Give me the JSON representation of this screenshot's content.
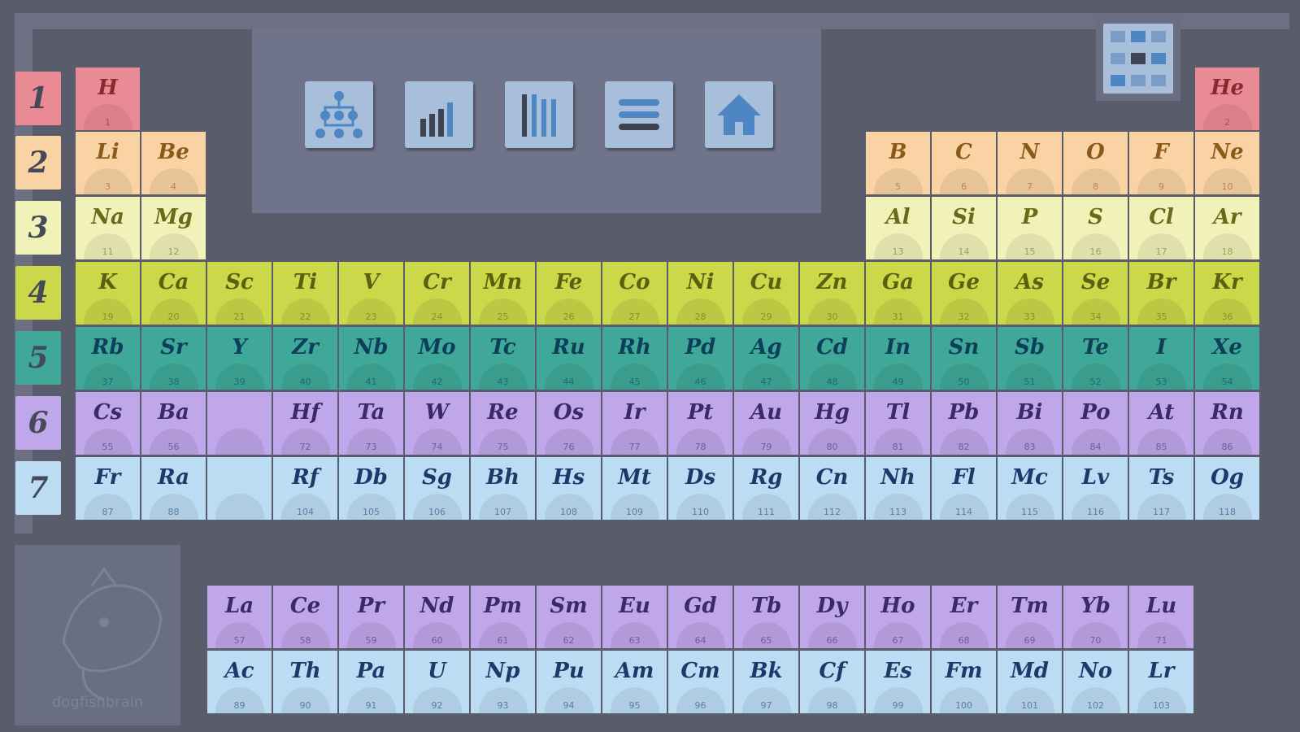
{
  "toolbar": {
    "buttons": [
      {
        "name": "tree-view-button",
        "icon": "tree-icon"
      },
      {
        "name": "chart-view-button",
        "icon": "bar-chart-icon"
      },
      {
        "name": "columns-view-button",
        "icon": "columns-icon"
      },
      {
        "name": "list-view-button",
        "icon": "list-icon"
      },
      {
        "name": "home-button",
        "icon": "home-icon"
      }
    ],
    "grid_button_icon": "grid-icon"
  },
  "periods": [
    "1",
    "2",
    "3",
    "4",
    "5",
    "6",
    "7"
  ],
  "period_colors": [
    "#ea8a94",
    "#f9d3a3",
    "#f0f2b8",
    "#cbd84a",
    "#3fa898",
    "#c0a6ea",
    "#bcdcf4"
  ],
  "period_text_colors": [
    "#8a2a30",
    "#8a5a1a",
    "#6a6a1a",
    "#5a6010",
    "#0e3f5a",
    "#3a2a6a",
    "#1a3a6a"
  ],
  "elements": [
    {
      "s": "H",
      "n": 1,
      "r": 1,
      "c": 1
    },
    {
      "s": "He",
      "n": 2,
      "r": 1,
      "c": 18
    },
    {
      "s": "Li",
      "n": 3,
      "r": 2,
      "c": 1
    },
    {
      "s": "Be",
      "n": 4,
      "r": 2,
      "c": 2
    },
    {
      "s": "B",
      "n": 5,
      "r": 2,
      "c": 13
    },
    {
      "s": "C",
      "n": 6,
      "r": 2,
      "c": 14
    },
    {
      "s": "N",
      "n": 7,
      "r": 2,
      "c": 15
    },
    {
      "s": "O",
      "n": 8,
      "r": 2,
      "c": 16
    },
    {
      "s": "F",
      "n": 9,
      "r": 2,
      "c": 17
    },
    {
      "s": "Ne",
      "n": 10,
      "r": 2,
      "c": 18
    },
    {
      "s": "Na",
      "n": 11,
      "r": 3,
      "c": 1
    },
    {
      "s": "Mg",
      "n": 12,
      "r": 3,
      "c": 2
    },
    {
      "s": "Al",
      "n": 13,
      "r": 3,
      "c": 13
    },
    {
      "s": "Si",
      "n": 14,
      "r": 3,
      "c": 14
    },
    {
      "s": "P",
      "n": 15,
      "r": 3,
      "c": 15
    },
    {
      "s": "S",
      "n": 16,
      "r": 3,
      "c": 16
    },
    {
      "s": "Cl",
      "n": 17,
      "r": 3,
      "c": 17
    },
    {
      "s": "Ar",
      "n": 18,
      "r": 3,
      "c": 18
    },
    {
      "s": "K",
      "n": 19,
      "r": 4,
      "c": 1
    },
    {
      "s": "Ca",
      "n": 20,
      "r": 4,
      "c": 2
    },
    {
      "s": "Sc",
      "n": 21,
      "r": 4,
      "c": 3
    },
    {
      "s": "Ti",
      "n": 22,
      "r": 4,
      "c": 4
    },
    {
      "s": "V",
      "n": 23,
      "r": 4,
      "c": 5
    },
    {
      "s": "Cr",
      "n": 24,
      "r": 4,
      "c": 6
    },
    {
      "s": "Mn",
      "n": 25,
      "r": 4,
      "c": 7
    },
    {
      "s": "Fe",
      "n": 26,
      "r": 4,
      "c": 8
    },
    {
      "s": "Co",
      "n": 27,
      "r": 4,
      "c": 9
    },
    {
      "s": "Ni",
      "n": 28,
      "r": 4,
      "c": 10
    },
    {
      "s": "Cu",
      "n": 29,
      "r": 4,
      "c": 11
    },
    {
      "s": "Zn",
      "n": 30,
      "r": 4,
      "c": 12
    },
    {
      "s": "Ga",
      "n": 31,
      "r": 4,
      "c": 13
    },
    {
      "s": "Ge",
      "n": 32,
      "r": 4,
      "c": 14
    },
    {
      "s": "As",
      "n": 33,
      "r": 4,
      "c": 15
    },
    {
      "s": "Se",
      "n": 34,
      "r": 4,
      "c": 16
    },
    {
      "s": "Br",
      "n": 35,
      "r": 4,
      "c": 17
    },
    {
      "s": "Kr",
      "n": 36,
      "r": 4,
      "c": 18
    },
    {
      "s": "Rb",
      "n": 37,
      "r": 5,
      "c": 1
    },
    {
      "s": "Sr",
      "n": 38,
      "r": 5,
      "c": 2
    },
    {
      "s": "Y",
      "n": 39,
      "r": 5,
      "c": 3
    },
    {
      "s": "Zr",
      "n": 40,
      "r": 5,
      "c": 4
    },
    {
      "s": "Nb",
      "n": 41,
      "r": 5,
      "c": 5
    },
    {
      "s": "Mo",
      "n": 42,
      "r": 5,
      "c": 6
    },
    {
      "s": "Tc",
      "n": 43,
      "r": 5,
      "c": 7
    },
    {
      "s": "Ru",
      "n": 44,
      "r": 5,
      "c": 8
    },
    {
      "s": "Rh",
      "n": 45,
      "r": 5,
      "c": 9
    },
    {
      "s": "Pd",
      "n": 46,
      "r": 5,
      "c": 10
    },
    {
      "s": "Ag",
      "n": 47,
      "r": 5,
      "c": 11
    },
    {
      "s": "Cd",
      "n": 48,
      "r": 5,
      "c": 12
    },
    {
      "s": "In",
      "n": 49,
      "r": 5,
      "c": 13
    },
    {
      "s": "Sn",
      "n": 50,
      "r": 5,
      "c": 14
    },
    {
      "s": "Sb",
      "n": 51,
      "r": 5,
      "c": 15
    },
    {
      "s": "Te",
      "n": 52,
      "r": 5,
      "c": 16
    },
    {
      "s": "I",
      "n": 53,
      "r": 5,
      "c": 17
    },
    {
      "s": "Xe",
      "n": 54,
      "r": 5,
      "c": 18
    },
    {
      "s": "Cs",
      "n": 55,
      "r": 6,
      "c": 1
    },
    {
      "s": "Ba",
      "n": 56,
      "r": 6,
      "c": 2
    },
    {
      "s": "",
      "n": "",
      "r": 6,
      "c": 3
    },
    {
      "s": "Hf",
      "n": 72,
      "r": 6,
      "c": 4
    },
    {
      "s": "Ta",
      "n": 73,
      "r": 6,
      "c": 5
    },
    {
      "s": "W",
      "n": 74,
      "r": 6,
      "c": 6
    },
    {
      "s": "Re",
      "n": 75,
      "r": 6,
      "c": 7
    },
    {
      "s": "Os",
      "n": 76,
      "r": 6,
      "c": 8
    },
    {
      "s": "Ir",
      "n": 77,
      "r": 6,
      "c": 9
    },
    {
      "s": "Pt",
      "n": 78,
      "r": 6,
      "c": 10
    },
    {
      "s": "Au",
      "n": 79,
      "r": 6,
      "c": 11
    },
    {
      "s": "Hg",
      "n": 80,
      "r": 6,
      "c": 12
    },
    {
      "s": "Tl",
      "n": 81,
      "r": 6,
      "c": 13
    },
    {
      "s": "Pb",
      "n": 82,
      "r": 6,
      "c": 14
    },
    {
      "s": "Bi",
      "n": 83,
      "r": 6,
      "c": 15
    },
    {
      "s": "Po",
      "n": 84,
      "r": 6,
      "c": 16
    },
    {
      "s": "At",
      "n": 85,
      "r": 6,
      "c": 17
    },
    {
      "s": "Rn",
      "n": 86,
      "r": 6,
      "c": 18
    },
    {
      "s": "Fr",
      "n": 87,
      "r": 7,
      "c": 1
    },
    {
      "s": "Ra",
      "n": 88,
      "r": 7,
      "c": 2
    },
    {
      "s": "",
      "n": "",
      "r": 7,
      "c": 3
    },
    {
      "s": "Rf",
      "n": 104,
      "r": 7,
      "c": 4
    },
    {
      "s": "Db",
      "n": 105,
      "r": 7,
      "c": 5
    },
    {
      "s": "Sg",
      "n": 106,
      "r": 7,
      "c": 6
    },
    {
      "s": "Bh",
      "n": 107,
      "r": 7,
      "c": 7
    },
    {
      "s": "Hs",
      "n": 108,
      "r": 7,
      "c": 8
    },
    {
      "s": "Mt",
      "n": 109,
      "r": 7,
      "c": 9
    },
    {
      "s": "Ds",
      "n": 110,
      "r": 7,
      "c": 10
    },
    {
      "s": "Rg",
      "n": 111,
      "r": 7,
      "c": 11
    },
    {
      "s": "Cn",
      "n": 112,
      "r": 7,
      "c": 12
    },
    {
      "s": "Nh",
      "n": 113,
      "r": 7,
      "c": 13
    },
    {
      "s": "Fl",
      "n": 114,
      "r": 7,
      "c": 14
    },
    {
      "s": "Mc",
      "n": 115,
      "r": 7,
      "c": 15
    },
    {
      "s": "Lv",
      "n": 116,
      "r": 7,
      "c": 16
    },
    {
      "s": "Ts",
      "n": 117,
      "r": 7,
      "c": 17
    },
    {
      "s": "Og",
      "n": 118,
      "r": 7,
      "c": 18
    },
    {
      "s": "La",
      "n": 57,
      "r": 9,
      "c": 3
    },
    {
      "s": "Ce",
      "n": 58,
      "r": 9,
      "c": 4
    },
    {
      "s": "Pr",
      "n": 59,
      "r": 9,
      "c": 5
    },
    {
      "s": "Nd",
      "n": 60,
      "r": 9,
      "c": 6
    },
    {
      "s": "Pm",
      "n": 61,
      "r": 9,
      "c": 7
    },
    {
      "s": "Sm",
      "n": 62,
      "r": 9,
      "c": 8
    },
    {
      "s": "Eu",
      "n": 63,
      "r": 9,
      "c": 9
    },
    {
      "s": "Gd",
      "n": 64,
      "r": 9,
      "c": 10
    },
    {
      "s": "Tb",
      "n": 65,
      "r": 9,
      "c": 11
    },
    {
      "s": "Dy",
      "n": 66,
      "r": 9,
      "c": 12
    },
    {
      "s": "Ho",
      "n": 67,
      "r": 9,
      "c": 13
    },
    {
      "s": "Er",
      "n": 68,
      "r": 9,
      "c": 14
    },
    {
      "s": "Tm",
      "n": 69,
      "r": 9,
      "c": 15
    },
    {
      "s": "Yb",
      "n": 70,
      "r": 9,
      "c": 16
    },
    {
      "s": "Lu",
      "n": 71,
      "r": 9,
      "c": 17
    },
    {
      "s": "Ac",
      "n": 89,
      "r": 10,
      "c": 3
    },
    {
      "s": "Th",
      "n": 90,
      "r": 10,
      "c": 4
    },
    {
      "s": "Pa",
      "n": 91,
      "r": 10,
      "c": 5
    },
    {
      "s": "U",
      "n": 92,
      "r": 10,
      "c": 6
    },
    {
      "s": "Np",
      "n": 93,
      "r": 10,
      "c": 7
    },
    {
      "s": "Pu",
      "n": 94,
      "r": 10,
      "c": 8
    },
    {
      "s": "Am",
      "n": 95,
      "r": 10,
      "c": 9
    },
    {
      "s": "Cm",
      "n": 96,
      "r": 10,
      "c": 10
    },
    {
      "s": "Bk",
      "n": 97,
      "r": 10,
      "c": 11
    },
    {
      "s": "Cf",
      "n": 98,
      "r": 10,
      "c": 12
    },
    {
      "s": "Es",
      "n": 99,
      "r": 10,
      "c": 13
    },
    {
      "s": "Fm",
      "n": 100,
      "r": 10,
      "c": 14
    },
    {
      "s": "Md",
      "n": 101,
      "r": 10,
      "c": 15
    },
    {
      "s": "No",
      "n": 102,
      "r": 10,
      "c": 16
    },
    {
      "s": "Lr",
      "n": 103,
      "r": 10,
      "c": 17
    }
  ],
  "logo": {
    "text": "dogfishbrain",
    "icon": "fox-logo-icon"
  }
}
